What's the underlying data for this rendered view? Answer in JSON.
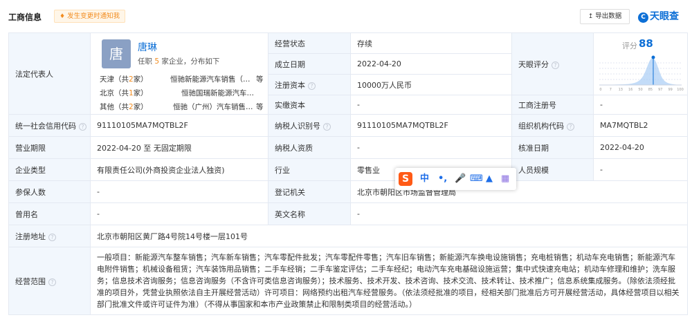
{
  "header": {
    "title": "工商信息",
    "notify_icon": "bell-icon",
    "notify_text": "发生变更时通知我",
    "export_icon": "export-icon",
    "export_label": "导出数据",
    "brand": "天眼查",
    "brand_logo": "C"
  },
  "legal": {
    "label": "法定代表人",
    "avatar_char": "唐",
    "name": "唐琳",
    "job_prefix": "任职",
    "job_count": "5",
    "job_suffix": "家企业，分布如下",
    "regions": [
      {
        "prefix": "天津（共",
        "count": "2",
        "suffix": "家）",
        "company": "恒驰新能源汽车销售（天津）有限公司",
        "more": "等"
      },
      {
        "prefix": "北京（共",
        "count": "1",
        "suffix": "家）",
        "company": "恒驰国瑞新能源汽车销售（北京）有限公司",
        "more": ""
      },
      {
        "prefix": "其他（共",
        "count": "2",
        "suffix": "家）",
        "company": "恒驰（广州）汽车销售有限公司",
        "more": "等"
      }
    ]
  },
  "fields": {
    "status_label": "经营状态",
    "status_value": "存续",
    "founded_label": "成立日期",
    "founded_value": "2022-04-20",
    "reg_capital_label": "注册资本",
    "reg_capital_value": "10000万人民币",
    "paid_capital_label": "实缴资本",
    "paid_capital_value": "-",
    "rating_label": "天眼评分",
    "reg_no_label": "工商注册号",
    "reg_no_value": "-",
    "credit_code_label": "统一社会信用代码",
    "credit_code_value": "91110105MA7MQTBL2F",
    "taxpayer_id_label": "纳税人识别号",
    "taxpayer_id_value": "91110105MA7MQTBL2F",
    "org_code_label": "组织机构代码",
    "org_code_value": "MA7MQTBL2",
    "term_label": "营业期限",
    "term_value": "2022-04-20 至 无固定期限",
    "taxpayer_qual_label": "纳税人资质",
    "taxpayer_qual_value": "-",
    "approval_label": "核准日期",
    "approval_value": "2022-04-20",
    "type_label": "企业类型",
    "type_value": "有限责任公司(外商投资企业法人独资)",
    "industry_label": "行业",
    "industry_value": "零售业",
    "staff_label": "人员规模",
    "staff_value": "-",
    "insured_label": "参保人数",
    "insured_value": "-",
    "authority_label": "登记机关",
    "authority_value": "北京市朝阳区市场监督管理局",
    "former_label": "曾用名",
    "former_value": "-",
    "english_label": "英文名称",
    "english_value": "-",
    "address_label": "注册地址",
    "address_value": "北京市朝阳区黄厂路4号院14号楼一层101号",
    "scope_label": "经营范围",
    "scope_value": "一般项目：新能源汽车整车销售；汽车新车销售；汽车零配件批发；汽车零配件零售；汽车旧车销售；新能源汽车换电设施销售；充电桩销售；机动车充电销售；新能源汽车电附件销售；机械设备租赁；汽车装饰用品销售；二手车经销；二手车鉴定评估；二手车经纪；电动汽车充电基础设施运营；集中式快速充电站；机动车修理和维护；洗车服务；信息技术咨询服务；信息咨询服务（不含许可类信息咨询服务）；技术服务、技术开发、技术咨询、技术交流、技术转让、技术推广；信息系统集成服务。（除依法须经批准的项目外，凭营业执照依法自主开展经营活动）许可项目：网络预约出租汽车经营服务。（依法须经批准的项目，经相关部门批准后方可开展经营活动，具体经营项目以相关部门批准文件或许可证件为准）（不得从事国家和本市产业政策禁止和限制类项目的经营活动。）"
  },
  "rating": {
    "label": "评分",
    "score": "88",
    "score_fraction": 0.88,
    "ticks": [
      "0",
      "7",
      "13",
      "16",
      "50",
      "85",
      "97",
      "99",
      "100"
    ]
  },
  "ime_toolbar": {
    "logo": "S",
    "items": [
      "中",
      "•,",
      "mic-icon",
      "keyboard-icon",
      "shirt-icon",
      "grid-icon"
    ]
  },
  "colors": {
    "accent": "#0d6fd6",
    "label_bg": "#f2f7fd",
    "highlight": "#f28c1f",
    "border": "#e4e9f2"
  }
}
